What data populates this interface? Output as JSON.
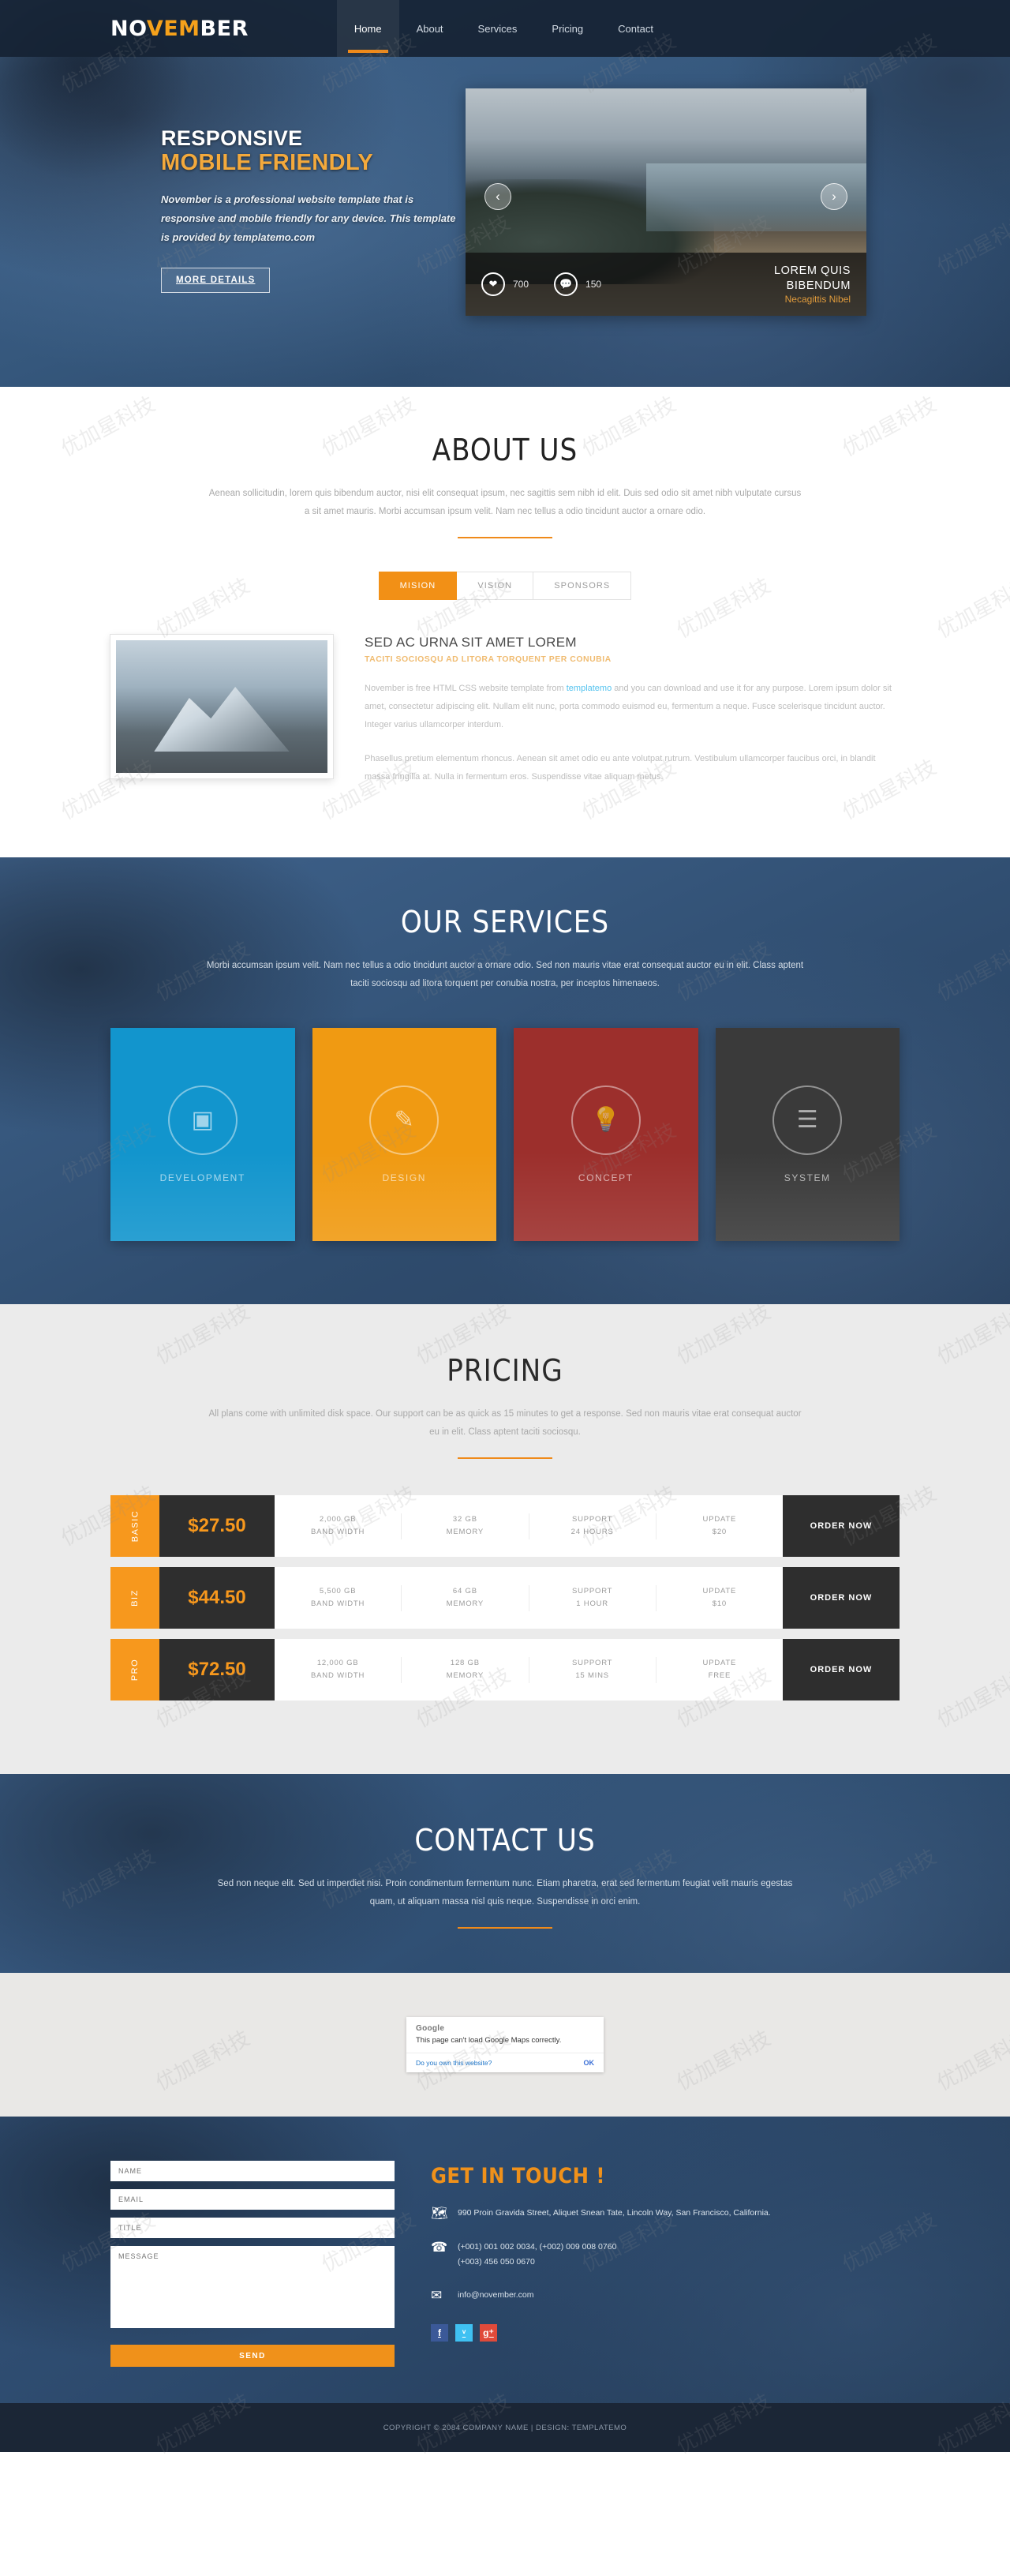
{
  "nav": {
    "logo_part1": "NO",
    "logo_part2": "VEM",
    "logo_part3": "BER",
    "items": [
      {
        "label": "Home",
        "active": true
      },
      {
        "label": "About",
        "active": false
      },
      {
        "label": "Services",
        "active": false
      },
      {
        "label": "Pricing",
        "active": false
      },
      {
        "label": "Contact",
        "active": false
      }
    ]
  },
  "hero": {
    "title_line1": "RESPONSIVE",
    "title_line2": "MOBILE FRIENDLY",
    "paragraph": "November is a professional website template that is responsive and mobile friendly for any device. This template is provided by templatemo.com",
    "button": "MORE DETAILS",
    "slider": {
      "prev_icon": "‹",
      "next_icon": "›",
      "likes_icon": "heart-icon",
      "likes": "700",
      "comments_icon": "comment-icon",
      "comments": "150",
      "caption_line1": "LOREM QUIS",
      "caption_line2": "BIBENDUM",
      "caption_sub": "Necagittis Nibel"
    }
  },
  "about": {
    "title": "ABOUT US",
    "subtitle": "Aenean sollicitudin, lorem quis bibendum auctor, nisi elit consequat ipsum, nec sagittis sem nibh id elit. Duis sed odio sit amet nibh vulputate cursus a sit amet mauris. Morbi accumsan ipsum velit. Nam nec tellus a odio tincidunt auctor a ornare odio.",
    "tabs": [
      {
        "label": "MISION",
        "active": true
      },
      {
        "label": "VISION",
        "active": false
      },
      {
        "label": "SPONSORS",
        "active": false
      }
    ],
    "heading": "SED AC URNA SIT AMET LOREM",
    "subheading": "TACITI SOCIOSQU AD LITORA TORQUENT PER CONUBIA",
    "para1_a": "November is free HTML CSS website template from ",
    "para1_link": "templatemo",
    "para1_b": " and you can download and use it for any purpose. Lorem ipsum dolor sit amet, consectetur adipiscing elit. Nullam elit nunc, porta commodo euismod eu, fermentum a neque. Fusce scelerisque tincidunt auctor. Integer varius ullamcorper interdum.",
    "para2": "Phasellus pretium elementum rhoncus. Aenean sit amet odio eu ante volutpat rutrum. Vestibulum ullamcorper faucibus orci, in blandit massa fringilla at. Nulla in fermentum eros. Suspendisse vitae aliquam metus."
  },
  "services": {
    "title": "OUR SERVICES",
    "subtitle": "Morbi accumsan ipsum velit. Nam nec tellus a odio tincidunt auctor a ornare odio. Sed non mauris vitae erat consequat auctor eu in elit. Class aptent taciti sociosqu ad litora torquent per conubia nostra, per inceptos himenaeos.",
    "cards": [
      {
        "label": "DEVELOPMENT",
        "icon": "monitor-icon",
        "glyph": "▣",
        "color": "#1295cd"
      },
      {
        "label": "DESIGN",
        "icon": "pencil-icon",
        "glyph": "✎",
        "color": "#f09a12"
      },
      {
        "label": "CONCEPT",
        "icon": "lightbulb-icon",
        "glyph": "○",
        "color": "#9c2f2c"
      },
      {
        "label": "SYSTEM",
        "icon": "sliders-icon",
        "glyph": "☰",
        "color": "#3a3a3a"
      }
    ]
  },
  "pricing": {
    "title": "PRICING",
    "subtitle": "All plans come with unlimited disk space. Our support can be as quick as 15 minutes to get a response. Sed non mauris vitae erat consequat auctor eu in elit. Class aptent taciti sociosqu.",
    "rows": [
      {
        "name": "BASIC",
        "price": "$27.50",
        "bandwidth": "2,000 GB\nBAND WIDTH",
        "memory": "32 GB\nMEMORY",
        "support": "SUPPORT\n24 HOURS",
        "update": "UPDATE\n$20",
        "order": "ORDER NOW"
      },
      {
        "name": "BIZ",
        "price": "$44.50",
        "bandwidth": "5,500 GB\nBAND WIDTH",
        "memory": "64 GB\nMEMORY",
        "support": "SUPPORT\n1 HOUR",
        "update": "UPDATE\n$10",
        "order": "ORDER NOW"
      },
      {
        "name": "PRO",
        "price": "$72.50",
        "bandwidth": "12,000 GB\nBAND WIDTH",
        "memory": "128 GB\nMEMORY",
        "support": "SUPPORT\n15 MINS",
        "update": "UPDATE\nFREE",
        "order": "ORDER NOW"
      }
    ]
  },
  "contact": {
    "title": "CONTACT US",
    "subtitle": "Sed non neque elit. Sed ut imperdiet nisi. Proin condimentum fermentum nunc. Etiam pharetra, erat sed fermentum feugiat velit mauris egestas quam, ut aliquam massa nisl quis neque. Suspendisse in orci enim."
  },
  "map": {
    "brand": "Google",
    "message": "This page can't load Google Maps correctly.",
    "link": "Do you own this website?",
    "ok": "OK"
  },
  "touch": {
    "heading": "GET IN TOUCH !",
    "fields": {
      "name_placeholder": "NAME",
      "email_placeholder": "EMAIL",
      "title_placeholder": "TITLE",
      "message_placeholder": "MESSAGE"
    },
    "send_label": "SEND",
    "address_icon": "map-icon",
    "address": "990 Proin Gravida Street, Aliquet Snean Tate, Lincoln Way, San Francisco, California.",
    "phone_icon": "phone-icon",
    "phone": "(+001) 001 002 0034, (+002) 009 008 0760\n(+003) 456 050 0670",
    "email_icon": "envelope-icon",
    "email": "info@november.com",
    "socials": [
      {
        "name": "facebook-icon",
        "glyph": "f",
        "color": "#3b5998"
      },
      {
        "name": "twitter-icon",
        "glyph": "ᵛ",
        "color": "#3fc1f2"
      },
      {
        "name": "googleplus-icon",
        "glyph": "g⁺",
        "color": "#e04a3a"
      }
    ]
  },
  "footer": {
    "copyright": "COPYRIGHT © 2084 COMPANY NAME | DESIGN: TEMPLATEMO"
  }
}
